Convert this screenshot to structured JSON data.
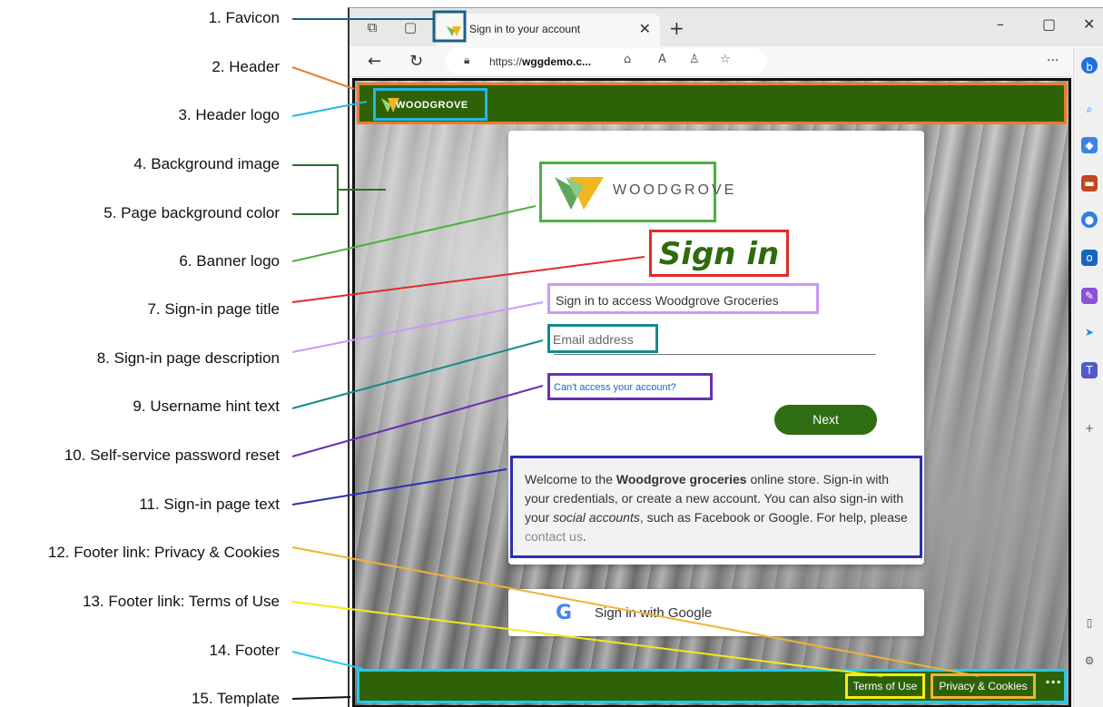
{
  "annotations": [
    "1. Favicon",
    "2. Header",
    "3. Header logo",
    "4. Background image",
    "5. Page background  color",
    "6. Banner logo",
    "7. Sign-in page title",
    "8. Sign-in page description",
    "9. Username hint text",
    "10. Self-service password reset",
    "11. Sign-in page text",
    "12. Footer link: Privacy & Cookies",
    "13. Footer link: Terms of Use",
    "14. Footer",
    "15. Template"
  ],
  "colors": {
    "header_bg": "#2d6306",
    "next_button": "#2f6d12",
    "title_text": "#2e6b0d",
    "link": "#1e62c4"
  },
  "browser": {
    "tab_title": "Sign in to your account",
    "url_prefix": "https://",
    "url_host": "wggdemo.c...",
    "icons": [
      "workspaces-icon",
      "tab-actions-icon",
      "close-icon",
      "new-tab-icon",
      "minimize-icon",
      "maximize-icon",
      "window-close-icon",
      "back-icon",
      "refresh-icon",
      "lock-icon",
      "app-available-icon",
      "read-aloud-icon",
      "profile-icon",
      "favorite-icon",
      "more-icon",
      "bing-icon",
      "search-icon",
      "tag-icon",
      "briefcase-icon",
      "copilot-icon",
      "outlook-icon",
      "designer-icon",
      "send-icon",
      "teams-icon",
      "add-icon",
      "sidebar-icon",
      "settings-icon"
    ]
  },
  "header": {
    "logo_text": "WOODGROVE"
  },
  "card": {
    "banner_text": "WOODGROVE",
    "title": "Sign in",
    "description": "Sign in to access Woodgrove Groceries",
    "username_placeholder": "Email address",
    "reset_link": "Can't access your account?",
    "next_label": "Next",
    "page_text": {
      "part1": "Welcome to the ",
      "bold": "Woodgrove groceries",
      "part2": " online store. Sign-in with your credentials, or create a new account. You can also sign-in with your ",
      "italic": "social accounts",
      "part3": ", such as Facebook or Google. For help, please ",
      "link": "contact us",
      "part4": "."
    }
  },
  "google": {
    "label": "Sign in with Google"
  },
  "footer": {
    "terms": "Terms of Use",
    "privacy": "Privacy & Cookies",
    "more": "···"
  }
}
